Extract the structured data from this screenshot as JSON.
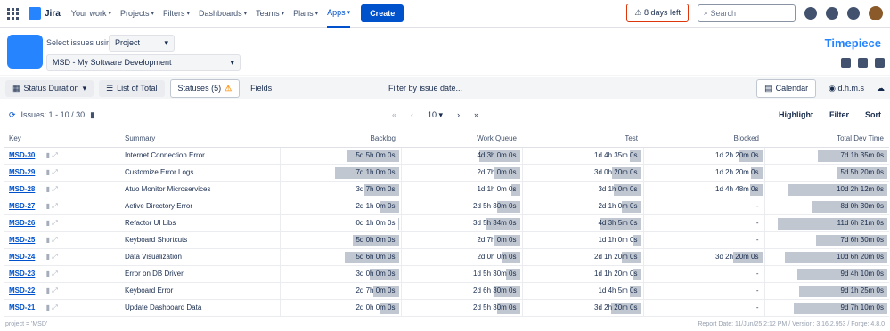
{
  "nav": {
    "logo": "Jira",
    "items": [
      "Your work",
      "Projects",
      "Filters",
      "Dashboards",
      "Teams",
      "Plans",
      "Apps"
    ],
    "create": "Create",
    "trial": "⚠ 8 days left",
    "search_placeholder": "Search"
  },
  "app": {
    "select_label": "Select issues using",
    "mode": "Project",
    "project": "MSD - My Software Development",
    "brand": "Timepiece"
  },
  "toolbar": {
    "status_duration": "Status Duration",
    "list_of_total": "List of Total",
    "statuses": "Statuses (5)",
    "fields": "Fields",
    "filter_date": "Filter by issue date...",
    "calendar": "Calendar",
    "dhms": "d.h.m.s"
  },
  "pager": {
    "issues": "Issues: 1 - 10 / 30",
    "page_size": "10",
    "highlight": "Highlight",
    "filter": "Filter",
    "sort": "Sort"
  },
  "columns": [
    "Key",
    "Summary",
    "Backlog",
    "Work Queue",
    "Test",
    "Blocked",
    "Total Dev Time"
  ],
  "rows": [
    {
      "key": "MSD-30",
      "summary": "Internet Connection Error",
      "backlog": "5d 5h 0m 0s",
      "work": "4d 3h 0m 0s",
      "test": "1d 4h 35m 0s",
      "blocked": "1d 2h 20m 0s",
      "total": "7d 1h 35m 0s",
      "bars": [
        0.45,
        0.35,
        0.1,
        0.2,
        0.58
      ]
    },
    {
      "key": "MSD-29",
      "summary": "Customize Error Logs",
      "backlog": "7d 1h 0m 0s",
      "work": "2d 7h 0m 0s",
      "test": "3d 0h 20m 0s",
      "blocked": "1d 2h 20m 0s",
      "total": "5d 5h 20m 0s",
      "bars": [
        0.55,
        0.22,
        0.25,
        0.1,
        0.42
      ]
    },
    {
      "key": "MSD-28",
      "summary": "Atuo Monitor Microservices",
      "backlog": "3d 7h 0m 0s",
      "work": "1d 1h 0m 0s",
      "test": "3d 1h 0m 0s",
      "blocked": "1d 4h 48m 0s",
      "total": "10d 2h 12m 0s",
      "bars": [
        0.3,
        0.08,
        0.24,
        0.11,
        0.83
      ]
    },
    {
      "key": "MSD-27",
      "summary": "Active Directory Error",
      "backlog": "2d 1h 0m 0s",
      "work": "2d 5h 30m 0s",
      "test": "2d 1h 0m 0s",
      "blocked": "-",
      "total": "8d 0h 30m 0s",
      "bars": [
        0.17,
        0.2,
        0.17,
        0,
        0.63
      ]
    },
    {
      "key": "MSD-26",
      "summary": "Refactor UI Libs",
      "backlog": "0d 1h 0m 0s",
      "work": "3d 5h 34m 0s",
      "test": "4d 3h 5m 0s",
      "blocked": "-",
      "total": "11d 6h 21m 0s",
      "bars": [
        0.01,
        0.3,
        0.35,
        0,
        0.92
      ]
    },
    {
      "key": "MSD-25",
      "summary": "Keyboard Shortcuts",
      "backlog": "5d 0h 0m 0s",
      "work": "2d 7h 0m 0s",
      "test": "1d 1h 0m 0s",
      "blocked": "-",
      "total": "7d 6h 30m 0s",
      "bars": [
        0.4,
        0.22,
        0.08,
        0,
        0.6
      ]
    },
    {
      "key": "MSD-24",
      "summary": "Data Visualization",
      "backlog": "5d 6h 0m 0s",
      "work": "2d 0h 0m 0s",
      "test": "2d 1h 20m 0s",
      "blocked": "3d 2h 20m 0s",
      "total": "10d 6h 20m 0s",
      "bars": [
        0.47,
        0.16,
        0.17,
        0.25,
        0.86
      ]
    },
    {
      "key": "MSD-23",
      "summary": "Error on DB Driver",
      "backlog": "3d 0h 0m 0s",
      "work": "1d 5h 30m 0s",
      "test": "1d 1h 20m 0s",
      "blocked": "-",
      "total": "9d 4h 10m 0s",
      "bars": [
        0.25,
        0.12,
        0.08,
        0,
        0.75
      ]
    },
    {
      "key": "MSD-22",
      "summary": "Keyboard Error",
      "backlog": "2d 7h 0m 0s",
      "work": "2d 6h 30m 0s",
      "test": "1d 4h 5m 0s",
      "blocked": "-",
      "total": "9d 1h 25m 0s",
      "bars": [
        0.22,
        0.22,
        0.1,
        0,
        0.74
      ]
    },
    {
      "key": "MSD-21",
      "summary": "Update Dashboard Data",
      "backlog": "2d 0h 0m 0s",
      "work": "2d 5h 30m 0s",
      "test": "3d 2h 20m 0s",
      "blocked": "-",
      "total": "9d 7h 10m 0s",
      "bars": [
        0.16,
        0.2,
        0.26,
        0,
        0.78
      ]
    }
  ],
  "footer": {
    "left": "project = 'MSD'",
    "right": "Report Date: 11/Jun/25 2:12 PM / Version: 3.16.2.953 / Forge: 4.8.0"
  }
}
